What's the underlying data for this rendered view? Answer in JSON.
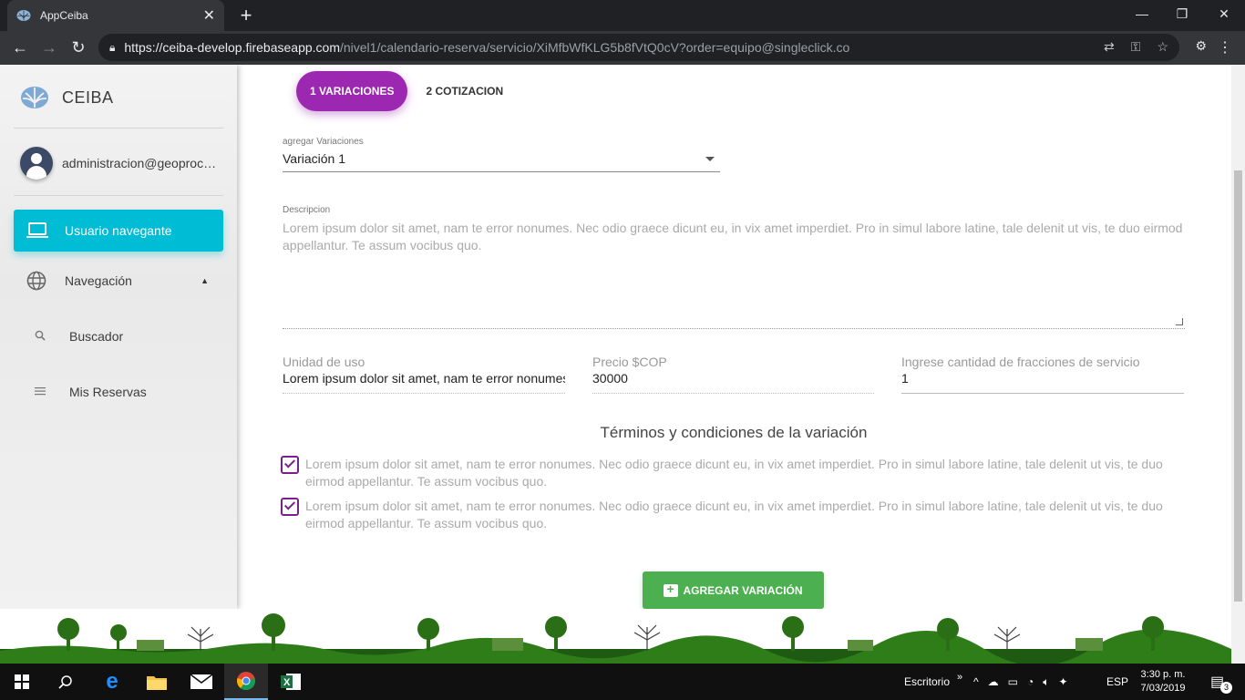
{
  "browser": {
    "tab_title": "AppCeiba",
    "url_host": "https://ceiba-develop.firebaseapp.com",
    "url_path": "/nivel1/calendario-reserva/servicio/XiMfbWfKLG5b8fVtQ0cV?order=equipo@singleclick.co"
  },
  "sidebar": {
    "brand": "CEIBA",
    "user_email": "administracion@geoprocesa...",
    "items": [
      {
        "label": "Usuario navegante",
        "icon": "laptop-icon"
      },
      {
        "label": "Navegación",
        "icon": "globe-icon"
      }
    ],
    "subitems": [
      {
        "label": "Buscador",
        "icon": "search-icon"
      },
      {
        "label": "Mis Reservas",
        "icon": "list-icon"
      }
    ]
  },
  "main": {
    "steps": [
      "1 VARIACIONES",
      "2 COTIZACION"
    ],
    "variation_label": "agregar Variaciones",
    "variation_value": "Variación 1",
    "description_label": "Descripcion",
    "description_text": "Lorem ipsum dolor sit amet, nam te error nonumes. Nec odio graece dicunt eu, in vix amet imperdiet. Pro in simul labore latine, tale delenit ut vis, te duo eirmod appellantur. Te assum vocibus quo.",
    "fields": [
      {
        "label": "Unidad de uso",
        "value": "Lorem ipsum dolor sit amet, nam te error nonumes"
      },
      {
        "label": "Precio $COP",
        "value": "30000"
      },
      {
        "label": "Ingrese cantidad de fracciones de servicio",
        "value": "1"
      }
    ],
    "terms_title": "Términos y condiciones de la variación",
    "terms": [
      {
        "text": "Lorem ipsum dolor sit amet, nam te error nonumes. Nec odio graece dicunt eu, in vix amet imperdiet. Pro in simul labore latine, tale delenit ut vis, te duo eirmod appellantur. Te assum vocibus quo.",
        "checked": true
      },
      {
        "text": "Lorem ipsum dolor sit amet, nam te error nonumes. Nec odio graece dicunt eu, in vix amet imperdiet. Pro in simul labore latine, tale delenit ut vis, te duo eirmod appellantur. Te assum vocibus quo.",
        "checked": true
      }
    ],
    "add_button": "AGREGAR VARIACIÓN"
  },
  "taskbar": {
    "desktop_label": "Escritorio",
    "language": "ESP",
    "time": "3:30 p. m.",
    "date": "7/03/2019",
    "notifications": "3"
  },
  "colors": {
    "accent_purple": "#9c27b0",
    "active_cyan": "#00bcd4",
    "button_green": "#4caf50"
  }
}
